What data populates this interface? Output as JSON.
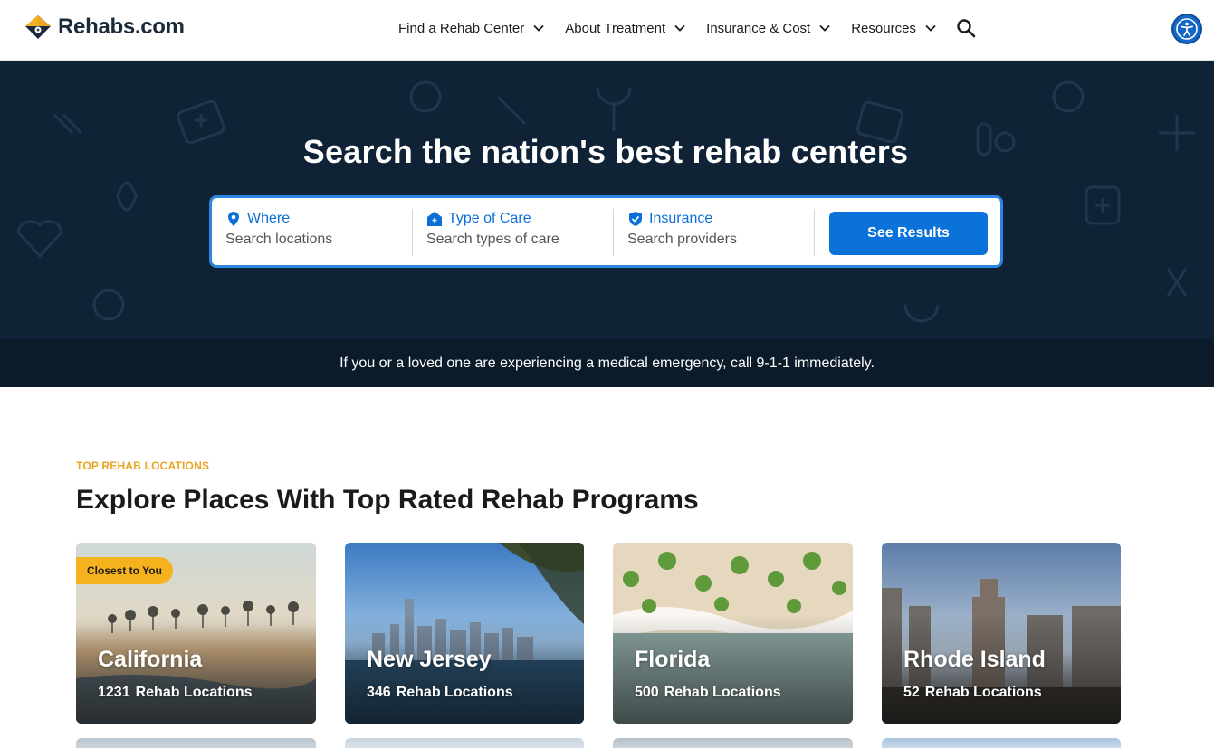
{
  "header": {
    "logo_text": "Rehabs.com",
    "nav": [
      {
        "label": "Find a Rehab Center"
      },
      {
        "label": "About Treatment"
      },
      {
        "label": "Insurance & Cost"
      },
      {
        "label": "Resources"
      }
    ],
    "icons": {
      "search": "search-icon",
      "accessibility": "accessibility-icon"
    }
  },
  "hero": {
    "title": "Search the nation's best rehab centers",
    "fields": [
      {
        "label": "Where",
        "placeholder": "Search locations",
        "icon": "location-pin-icon"
      },
      {
        "label": "Type of Care",
        "placeholder": "Search types of care",
        "icon": "house-icon"
      },
      {
        "label": "Insurance",
        "placeholder": "Search providers",
        "icon": "shield-check-icon"
      }
    ],
    "cta": "See Results",
    "emergency": "If you or a loved one are experiencing a medical emergency, call 9-1-1 immediately."
  },
  "section": {
    "eyebrow": "TOP REHAB LOCATIONS",
    "title": "Explore Places With Top Rated Rehab Programs",
    "cards": [
      {
        "name": "California",
        "count": "1231",
        "count_label": "Rehab Locations",
        "badge": "Closest to You"
      },
      {
        "name": "New Jersey",
        "count": "346",
        "count_label": "Rehab Locations"
      },
      {
        "name": "Florida",
        "count": "500",
        "count_label": "Rehab Locations"
      },
      {
        "name": "Rhode Island",
        "count": "52",
        "count_label": "Rehab Locations"
      }
    ]
  },
  "colors": {
    "brand_blue": "#0b72d9",
    "hero_bg": "#0f2236",
    "accent_yellow": "#f5b21d",
    "eyebrow": "#e8a623"
  }
}
